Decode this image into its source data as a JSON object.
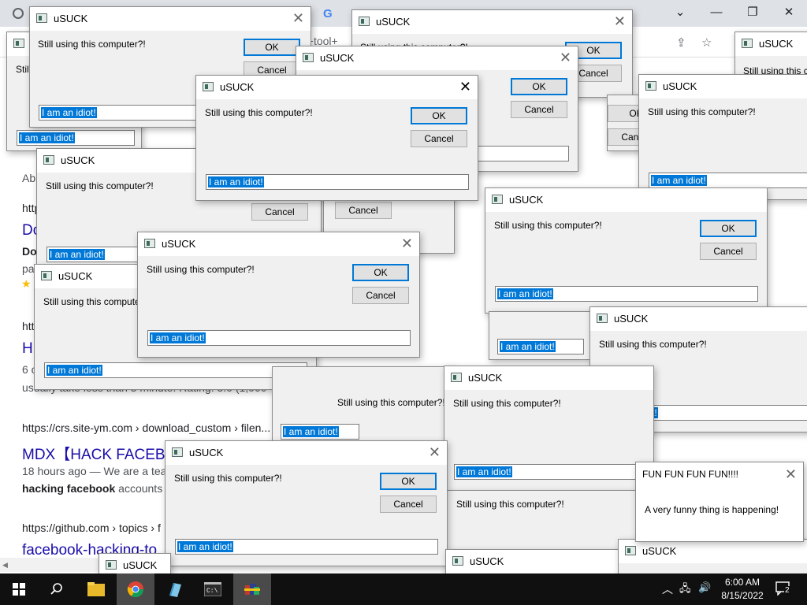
{
  "browser": {
    "omnibox_fragment": "q+tool+",
    "google_mark": "G",
    "controls": {
      "minimize": "—",
      "maximize": "❐",
      "close": "✕",
      "tabs_menu": "⌄"
    },
    "results": [
      {
        "url": "https://crs.site-ym.com › download_custom › filen...",
        "title": "MDX【HACK FACEB",
        "snippet_prefix": "18 hours ago — We are a tea",
        "snippet_bold": "hacking facebook",
        "snippet_rest": " accounts p"
      },
      {
        "url": "https://github.com › topics › f",
        "title": "facebook-hacking-to"
      }
    ],
    "fragments": {
      "ab": "Ab",
      "http1": "http",
      "do": "Do",
      "dow": "Dow",
      "pa": "pa",
      "star": "★",
      "htt2": "htt",
      "h": "H",
      "six": "6 c",
      "usually": "usually take less than 5 minute. Rating: 5.0 (1,000"
    }
  },
  "dialog": {
    "title": "uSUCK",
    "message": "Still using this computer?!",
    "ok_label": "OK",
    "cancel_label": "Cancel",
    "input_value": "I am an idiot!",
    "close_glyph": "✕"
  },
  "fun_dialog": {
    "title": "FUN FUN FUN FUN!!!!",
    "message": "A very funny thing is happening!"
  },
  "taskbar": {
    "time": "6:00 AM",
    "date": "8/15/2022",
    "notification_count": "2",
    "icons": [
      "windows-start-icon",
      "search-icon",
      "file-explorer-icon",
      "chrome-icon",
      "notepad-icon",
      "terminal-icon",
      "winrar-icon"
    ]
  },
  "partials": {
    "fragment_computer": "s-computer?!",
    "fragment_computer2": "computer?!"
  }
}
